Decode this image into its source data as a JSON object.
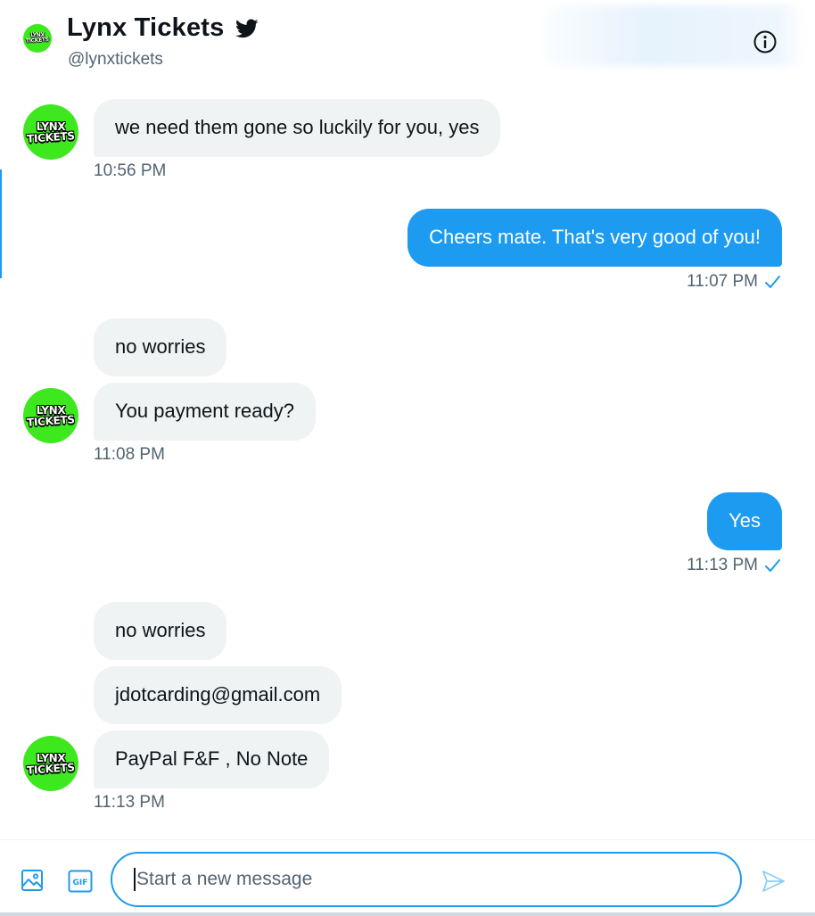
{
  "header": {
    "name": "Lynx Tickets",
    "handle": "@lynxtickets",
    "verified_icon": "twitter-bird-icon",
    "info_icon": "info-icon"
  },
  "avatar": {
    "line1": "LYNX",
    "line2": "TICKETS"
  },
  "messages": [
    {
      "side": "received",
      "text": "we need them gone so luckily for you, yes",
      "time": "10:56 PM"
    },
    {
      "side": "sent",
      "text": "Cheers mate. That's very good of you!",
      "time": "11:07 PM"
    },
    {
      "side": "received",
      "text": "no worries"
    },
    {
      "side": "received",
      "text": "You payment ready?",
      "time": "11:08 PM"
    },
    {
      "side": "sent",
      "text": "Yes",
      "time": "11:13 PM"
    },
    {
      "side": "received",
      "text": "no worries"
    },
    {
      "side": "received",
      "text": "jdotcarding@gmail.com"
    },
    {
      "side": "received",
      "text": "PayPal F&F , No Note",
      "time": "11:13 PM"
    }
  ],
  "composer": {
    "placeholder": "Start a new message",
    "media_icon": "image-icon",
    "gif_label": "GIF",
    "send_icon": "send-icon"
  },
  "colors": {
    "accent": "#1d9bf0",
    "received_bubble": "#eff3f4",
    "avatar_green": "#3ee81e"
  }
}
